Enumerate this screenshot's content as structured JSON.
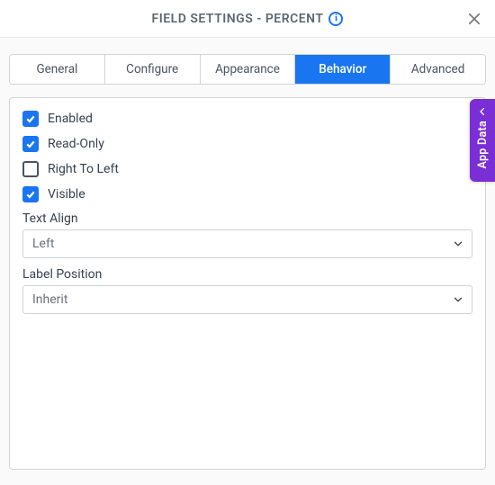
{
  "header": {
    "title": "FIELD SETTINGS - PERCENT"
  },
  "tabs": {
    "items": [
      {
        "label": "General"
      },
      {
        "label": "Configure"
      },
      {
        "label": "Appearance"
      },
      {
        "label": "Behavior"
      },
      {
        "label": "Advanced"
      }
    ],
    "activeIndex": 3
  },
  "behavior": {
    "checkboxes": [
      {
        "label": "Enabled",
        "checked": true
      },
      {
        "label": "Read-Only",
        "checked": true
      },
      {
        "label": "Right To Left",
        "checked": false
      },
      {
        "label": "Visible",
        "checked": true
      }
    ],
    "textAlign": {
      "label": "Text Align",
      "value": "Left"
    },
    "labelPosition": {
      "label": "Label Position",
      "value": "Inherit"
    }
  },
  "sideTab": {
    "label": "App Data"
  }
}
